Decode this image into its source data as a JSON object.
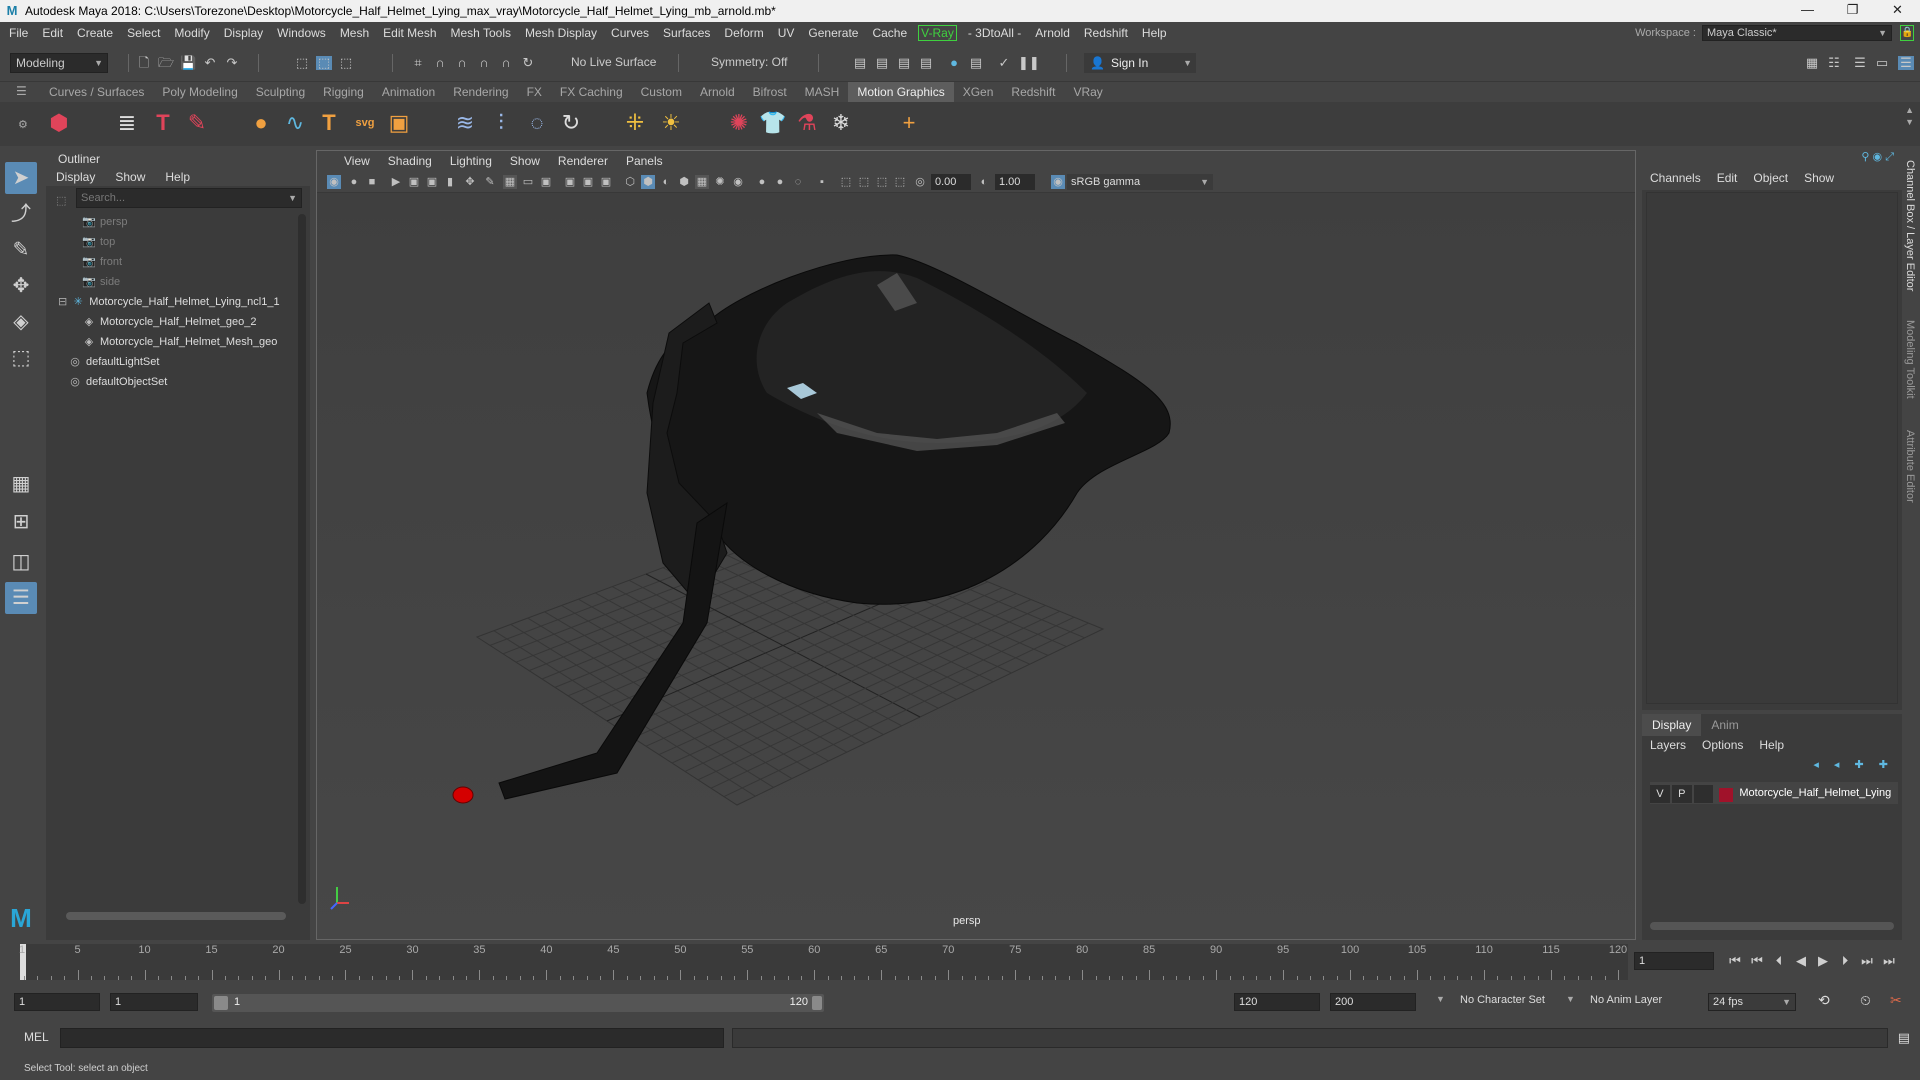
{
  "window": {
    "title": "Autodesk Maya 2018: C:\\Users\\Torezone\\Desktop\\Motorcycle_Half_Helmet_Lying_max_vray\\Motorcycle_Half_Helmet_Lying_mb_arnold.mb*",
    "minimize": "—",
    "restore": "❐",
    "close": "✕"
  },
  "menubar": {
    "items": [
      "File",
      "Edit",
      "Create",
      "Select",
      "Modify",
      "Display",
      "Windows",
      "Mesh",
      "Edit Mesh",
      "Mesh Tools",
      "Mesh Display",
      "Curves",
      "Surfaces",
      "Deform",
      "UV",
      "Generate",
      "Cache",
      "V-Ray",
      "- 3DtoAll -",
      "Arnold",
      "Redshift",
      "Help"
    ],
    "workspace_label": "Workspace :",
    "workspace_value": "Maya Classic*"
  },
  "statusline": {
    "mode": "Modeling",
    "live_surface": "No Live Surface",
    "symmetry": "Symmetry: Off",
    "sign_in": "Sign In"
  },
  "shelf": {
    "tabs": [
      "Curves / Surfaces",
      "Poly Modeling",
      "Sculpting",
      "Rigging",
      "Animation",
      "Rendering",
      "FX",
      "FX Caching",
      "Custom",
      "Arnold",
      "Bifrost",
      "MASH",
      "Motion Graphics",
      "XGen",
      "Redshift",
      "VRay"
    ],
    "active_tab": "Motion Graphics"
  },
  "outliner": {
    "title": "Outliner",
    "menu": [
      "Display",
      "Show",
      "Help"
    ],
    "search_placeholder": "Search...",
    "items": [
      {
        "label": "persp",
        "dim": true
      },
      {
        "label": "top",
        "dim": true
      },
      {
        "label": "front",
        "dim": true
      },
      {
        "label": "side",
        "dim": true
      },
      {
        "label": "Motorcycle_Half_Helmet_Lying_ncl1_1",
        "dim": false
      },
      {
        "label": "Motorcycle_Half_Helmet_geo_2",
        "dim": false
      },
      {
        "label": "Motorcycle_Half_Helmet_Mesh_geo",
        "dim": false
      },
      {
        "label": "defaultLightSet",
        "dim": false
      },
      {
        "label": "defaultObjectSet",
        "dim": false
      }
    ]
  },
  "viewport": {
    "menu": [
      "View",
      "Shading",
      "Lighting",
      "Show",
      "Renderer",
      "Panels"
    ],
    "exposure": "0.00",
    "gamma": "1.00",
    "color_space": "sRGB gamma",
    "camera_label": "persp"
  },
  "channelbox": {
    "menu": [
      "Channels",
      "Edit",
      "Object",
      "Show"
    ]
  },
  "layereditor": {
    "tabs": [
      "Display",
      "Anim"
    ],
    "active_tab": "Display",
    "menu": [
      "Layers",
      "Options",
      "Help"
    ],
    "layer": {
      "v": "V",
      "p": "P",
      "name": "Motorcycle_Half_Helmet_Lying",
      "color": "#a0122a"
    }
  },
  "sidetabs": [
    "Channel Box / Layer Editor",
    "Modeling Toolkit",
    "Attribute Editor"
  ],
  "timeslider": {
    "ticks": [
      "1",
      "5",
      "10",
      "15",
      "20",
      "25",
      "30",
      "35",
      "40",
      "45",
      "50",
      "55",
      "60",
      "65",
      "70",
      "75",
      "80",
      "85",
      "90",
      "95",
      "100",
      "105",
      "110",
      "115",
      "120"
    ],
    "current_frame": "1"
  },
  "rangeslider": {
    "start": "1",
    "playback_start": "1",
    "range_start": "1",
    "range_end": "120",
    "playback_end": "120",
    "end": "200",
    "character_set": "No Character Set",
    "anim_layer": "No Anim Layer",
    "fps": "24 fps"
  },
  "cmdline": {
    "label": "MEL"
  },
  "helpline": {
    "text": "Select Tool: select an object"
  }
}
